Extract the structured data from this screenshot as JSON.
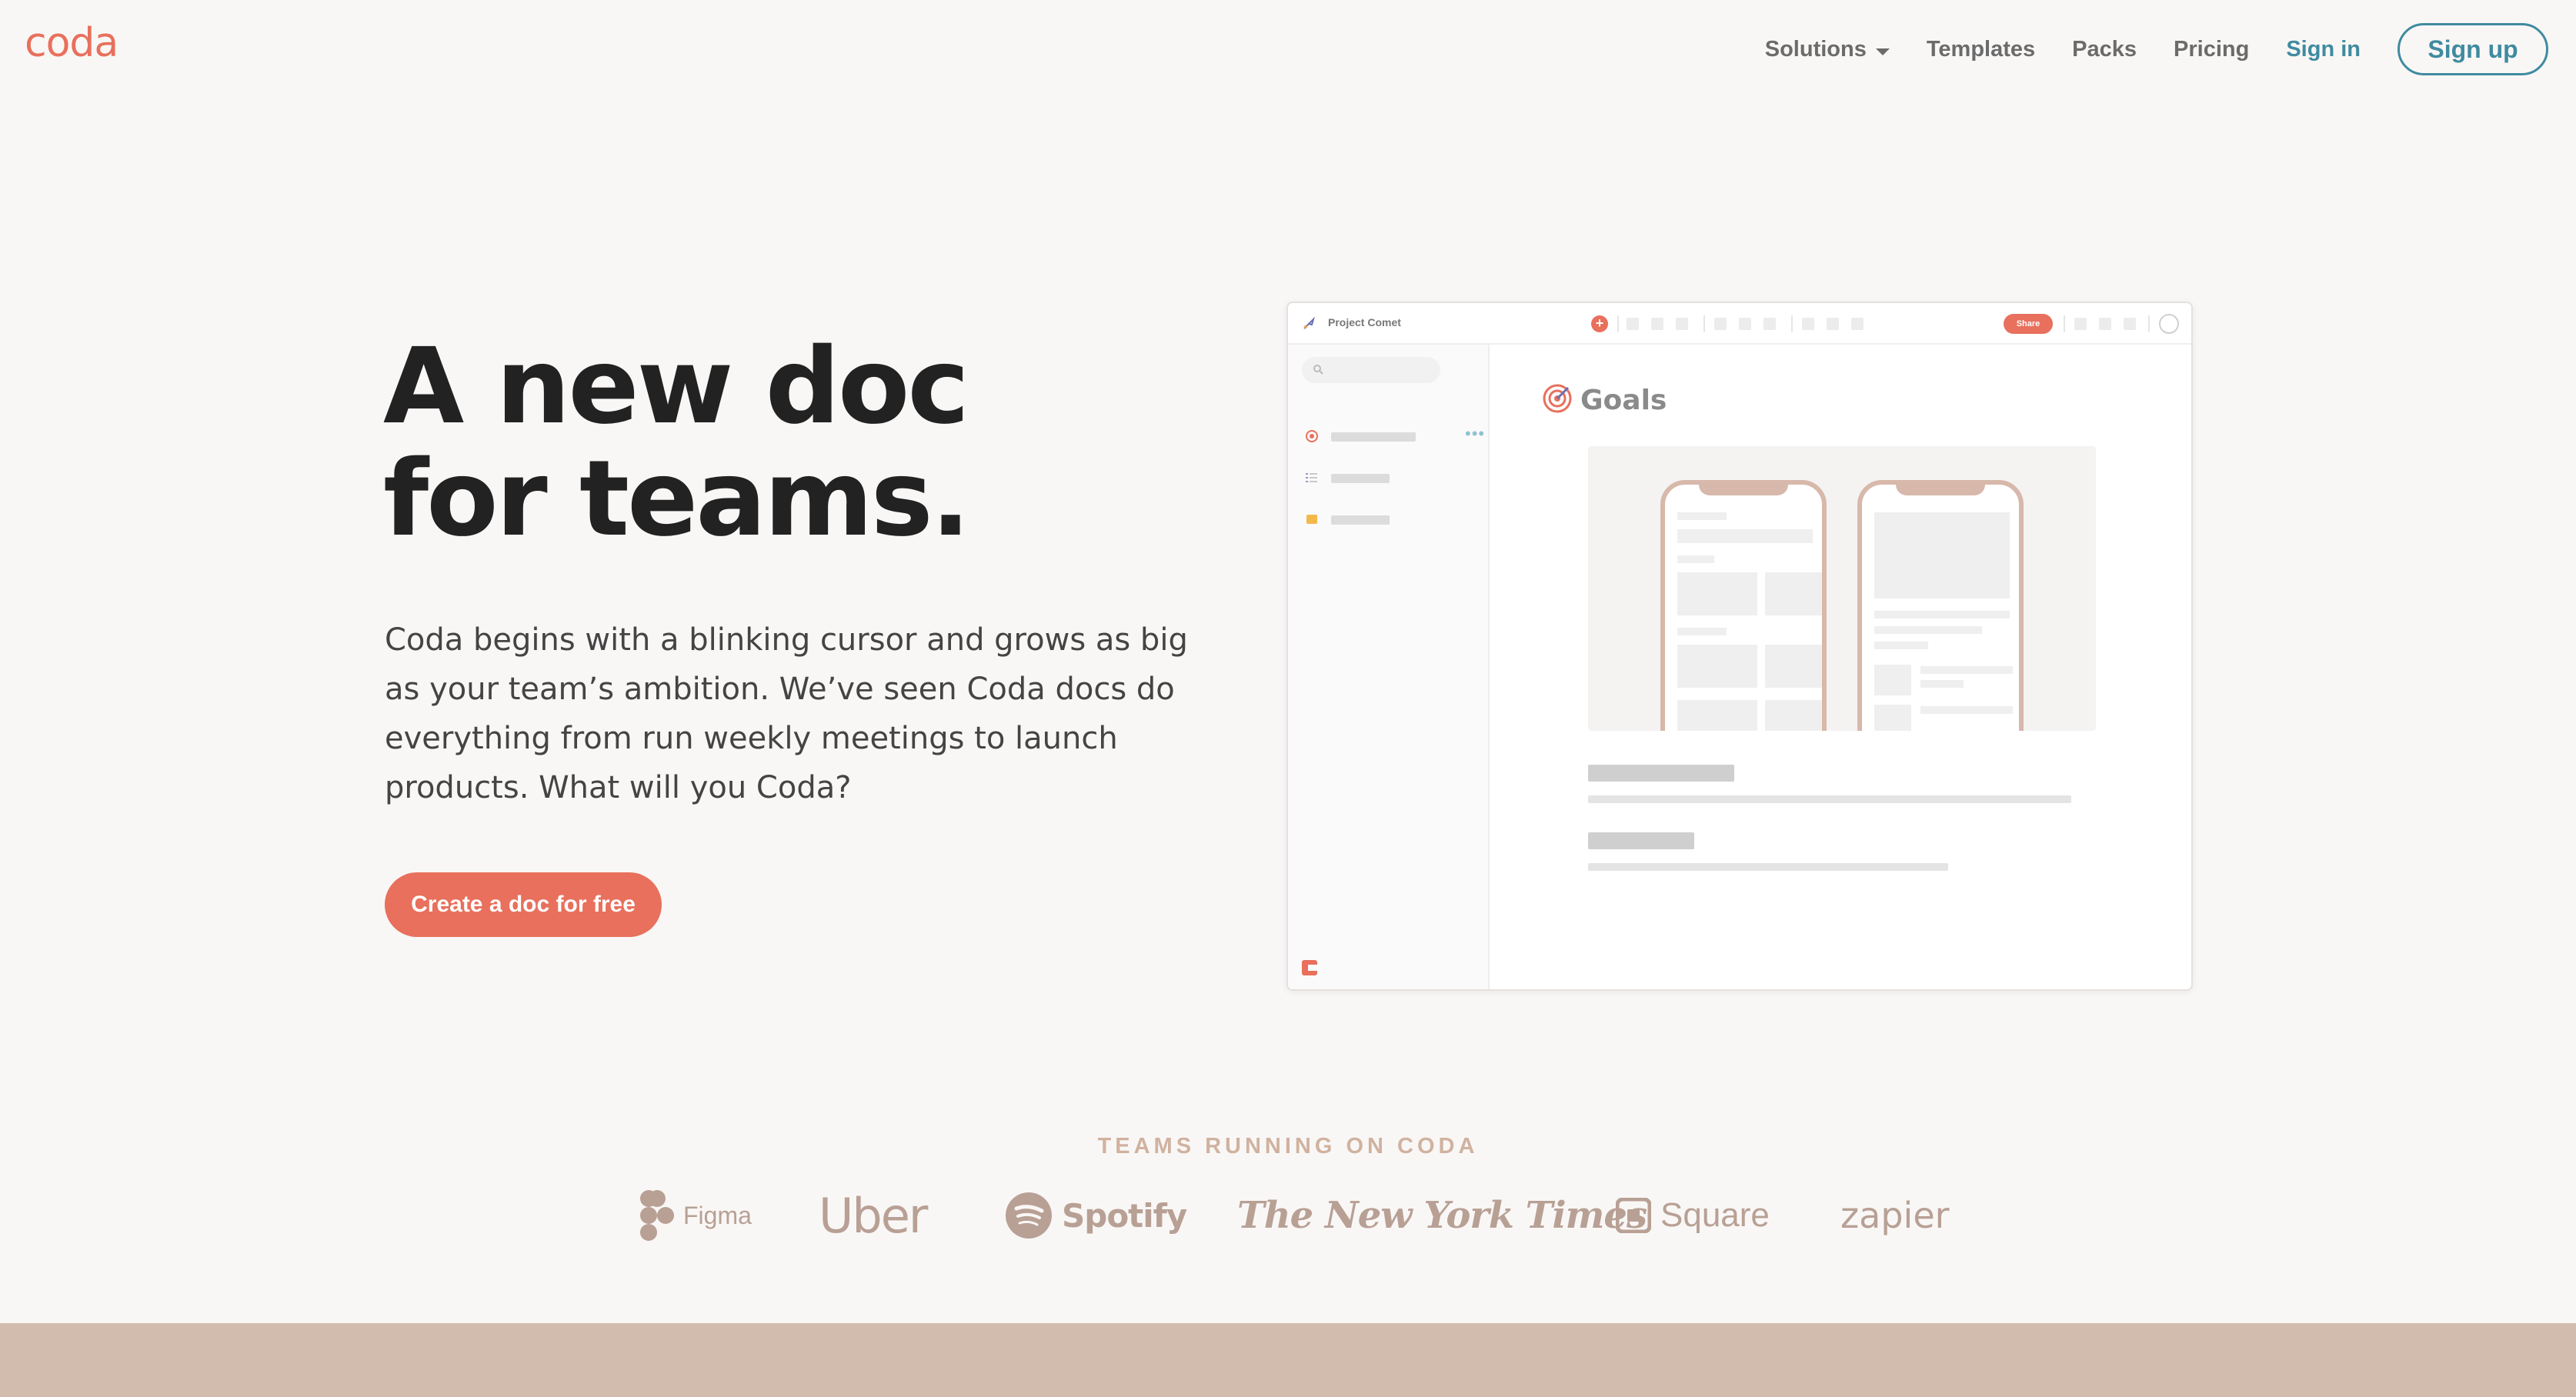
{
  "nav": {
    "logo": "coda",
    "solutions": "Solutions",
    "templates": "Templates",
    "packs": "Packs",
    "pricing": "Pricing",
    "sign_in": "Sign in",
    "sign_up": "Sign up"
  },
  "hero": {
    "title_line1": "A new doc",
    "title_line2": "for teams.",
    "body": "Coda begins with a blinking cursor and grows as big as your team’s ambition. We’ve seen Coda docs do everything from run weekly meetings to launch products. What will you Coda?",
    "cta": "Create a doc for free"
  },
  "preview": {
    "doc_name": "Project Comet",
    "share_label": "Share",
    "plus_label": "+",
    "page_title": "Goals",
    "more_dots": "•••"
  },
  "teams": {
    "label": "TEAMS RUNNING ON CODA",
    "logos": [
      "Figma",
      "Uber",
      "Spotify",
      "The New York Times",
      "Square",
      "zapier"
    ]
  },
  "colors": {
    "accent": "#e8705c",
    "link": "#3f8ba0",
    "background": "#f9f7f6",
    "band": "#d2bcae",
    "brand_logo": "#b8a095"
  }
}
